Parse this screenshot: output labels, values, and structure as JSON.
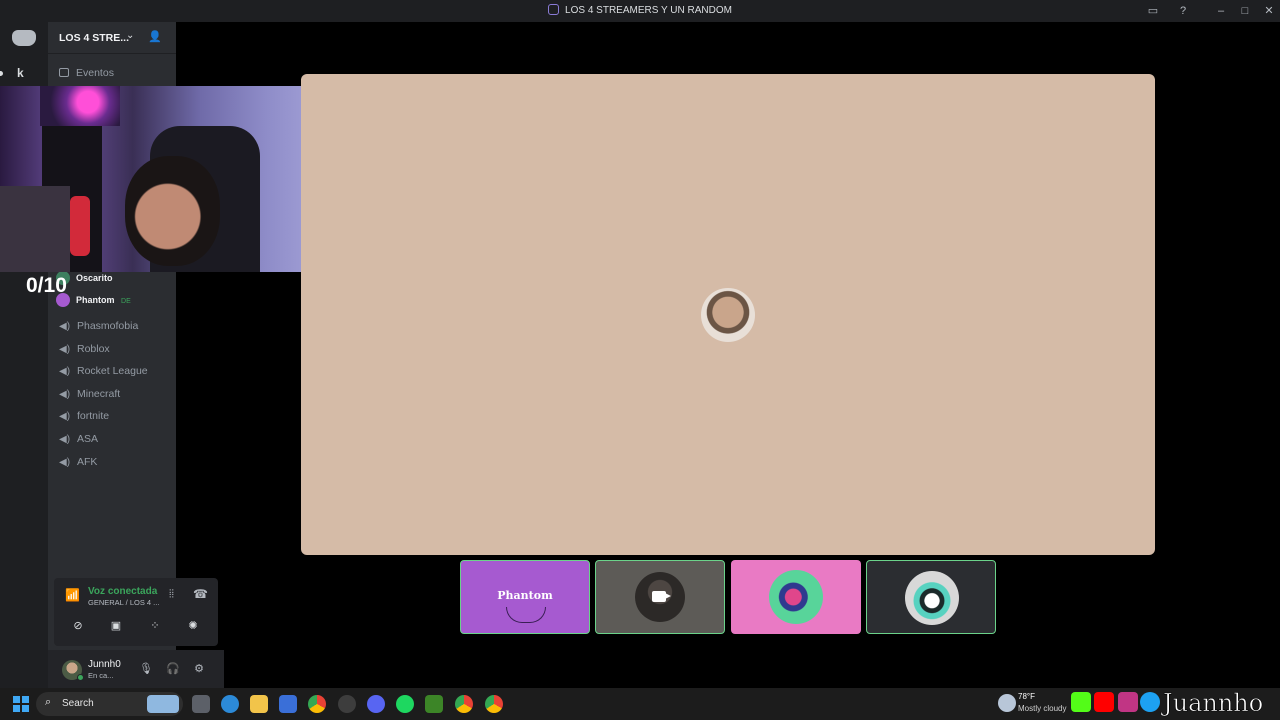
{
  "window": {
    "title": "LOS 4 STREAMERS Y UN RANDOM"
  },
  "rail": {
    "server_letter": "k"
  },
  "server": {
    "name": "LOS 4 STRE...",
    "events_label": "Eventos"
  },
  "voice_users": [
    {
      "name": "Oscarito"
    },
    {
      "name": "Phantom",
      "tag": "DE"
    }
  ],
  "channels": [
    {
      "name": "Phasmofobia"
    },
    {
      "name": "Roblox"
    },
    {
      "name": "Rocket League"
    },
    {
      "name": "Minecraft"
    },
    {
      "name": "fortnite"
    },
    {
      "name": "ASA"
    },
    {
      "name": "AFK"
    }
  ],
  "voice": {
    "status": "Voz conectada",
    "channel": "GENERAL / LOS 4 ..."
  },
  "self": {
    "name": "Junnh0",
    "status": "En ca..."
  },
  "overlay": {
    "counter": "0/10"
  },
  "tiles": [
    {
      "label": "Phantom"
    }
  ],
  "taskbar": {
    "search_placeholder": "Search",
    "weather_temp": "78°F",
    "weather_desc": "Mostly cloudy"
  },
  "stream_brand": "Juannho",
  "colors": {
    "connected": "#3ba55c",
    "stage_bg": "#d5bba7",
    "speaking_border": "#6bd38a"
  }
}
